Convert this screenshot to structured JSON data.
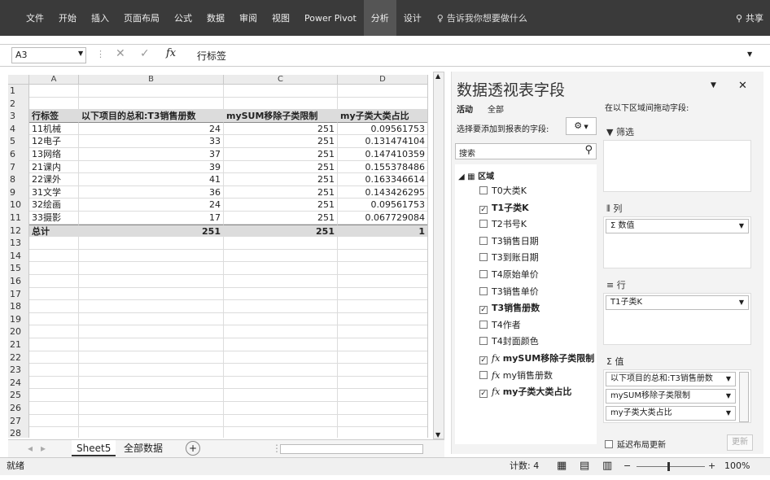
{
  "ribbon": {
    "tabs": [
      "文件",
      "开始",
      "插入",
      "页面布局",
      "公式",
      "数据",
      "审阅",
      "视图",
      "Power Pivot",
      "分析",
      "设计"
    ],
    "search": "告诉我你想要做什么",
    "share": "共享"
  },
  "formula": {
    "namebox": "A3",
    "value": "行标签"
  },
  "grid": {
    "columns": [
      "A",
      "B",
      "C",
      "D"
    ],
    "header": [
      "行标签",
      "以下项目的总和:T3销售册数",
      "mySUM移除子类限制",
      "my子类大类占比"
    ],
    "rows": [
      [
        "11机械",
        "24",
        "251",
        "0.09561753"
      ],
      [
        "12电子",
        "33",
        "251",
        "0.131474104"
      ],
      [
        "13网络",
        "37",
        "251",
        "0.147410359"
      ],
      [
        "21课内",
        "39",
        "251",
        "0.155378486"
      ],
      [
        "22课外",
        "41",
        "251",
        "0.163346614"
      ],
      [
        "31文学",
        "36",
        "251",
        "0.143426295"
      ],
      [
        "32绘画",
        "24",
        "251",
        "0.09561753"
      ],
      [
        "33摄影",
        "17",
        "251",
        "0.067729084"
      ]
    ],
    "total": [
      "总计",
      "251",
      "251",
      "1"
    ],
    "row_numbers": [
      "1",
      "2",
      "3",
      "4",
      "5",
      "6",
      "7",
      "8",
      "9",
      "10",
      "11",
      "12",
      "13",
      "14",
      "15",
      "16",
      "17",
      "18",
      "19",
      "20",
      "21",
      "22",
      "23",
      "24",
      "25",
      "26",
      "27",
      "28"
    ]
  },
  "sheets": {
    "tabs": [
      "Sheet5",
      "全部数据"
    ],
    "add": "+"
  },
  "status": {
    "ready": "就绪",
    "count": "计数: 4",
    "zoom": "100%"
  },
  "pane": {
    "title": "数据透视表字段",
    "tab_active": "活动",
    "tab_all": "全部",
    "choose_label": "选择要添加到报表的字段:",
    "search_placeholder": "搜索",
    "drag_label": "在以下区域间拖动字段:",
    "table_name": "区域",
    "fields": [
      {
        "name": "T0大类K",
        "checked": false,
        "bold": false,
        "fx": false
      },
      {
        "name": "T1子类K",
        "checked": true,
        "bold": true,
        "fx": false
      },
      {
        "name": "T2书号K",
        "checked": false,
        "bold": false,
        "fx": false
      },
      {
        "name": "T3销售日期",
        "checked": false,
        "bold": false,
        "fx": false
      },
      {
        "name": "T3到账日期",
        "checked": false,
        "bold": false,
        "fx": false
      },
      {
        "name": "T4原始单价",
        "checked": false,
        "bold": false,
        "fx": false
      },
      {
        "name": "T3销售单价",
        "checked": false,
        "bold": false,
        "fx": false
      },
      {
        "name": "T3销售册数",
        "checked": true,
        "bold": true,
        "fx": false
      },
      {
        "name": "T4作者",
        "checked": false,
        "bold": false,
        "fx": false
      },
      {
        "name": "T4封面颜色",
        "checked": false,
        "bold": false,
        "fx": false
      },
      {
        "name": "mySUM移除子类限制",
        "checked": true,
        "bold": true,
        "fx": true
      },
      {
        "name": "my销售册数",
        "checked": false,
        "bold": false,
        "fx": true
      },
      {
        "name": "my子类大类占比",
        "checked": true,
        "bold": true,
        "fx": true
      }
    ],
    "zones": {
      "filter": "筛选",
      "columns": "列",
      "columns_item": "Σ 数值",
      "rows": "行",
      "rows_item": "T1子类K",
      "values": "值",
      "values_items": [
        "以下项目的总和:T3销售册数",
        "mySUM移除子类限制",
        "my子类大类占比"
      ]
    },
    "defer": "延迟布局更新",
    "update": "更新"
  }
}
